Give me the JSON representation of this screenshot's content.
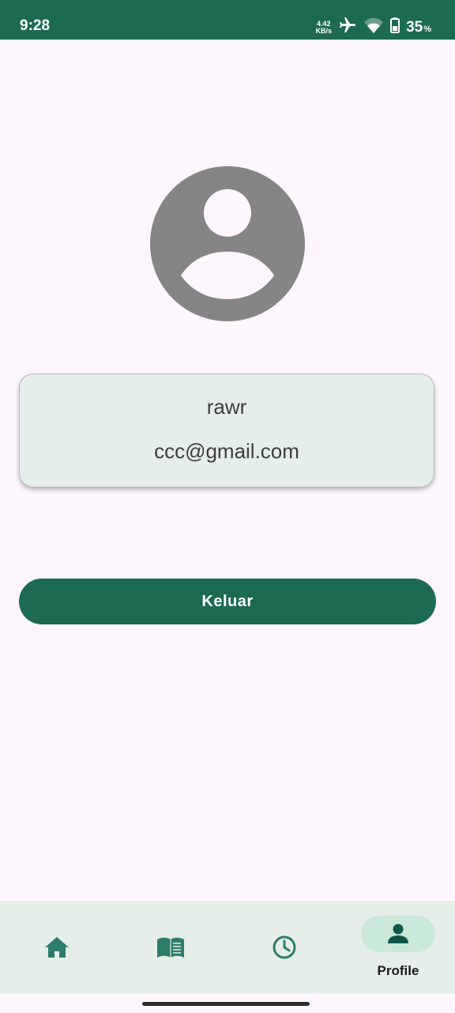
{
  "status_bar": {
    "time": "9:28",
    "net_speed_value": "4.42",
    "net_speed_unit": "KB/s",
    "battery_value": "35",
    "battery_unit": "%",
    "icons": [
      "airplane-mode-icon",
      "wifi-icon",
      "battery-icon"
    ]
  },
  "profile": {
    "avatar_icon": "account-circle-icon",
    "username": "rawr",
    "email": "ccc@gmail.com"
  },
  "actions": {
    "logout_label": "Keluar"
  },
  "bottom_nav": {
    "items": [
      {
        "icon": "home-icon",
        "label": ""
      },
      {
        "icon": "book-icon",
        "label": ""
      },
      {
        "icon": "clock-icon",
        "label": ""
      },
      {
        "icon": "person-icon",
        "label": "Profile",
        "selected": true
      }
    ]
  },
  "colors": {
    "primary": "#1C6A52",
    "background": "#FDF7FD",
    "card_background": "#E6EEEB",
    "nav_background": "#E6EEE9",
    "nav_selected_pill": "#C9E8DA",
    "avatar_gray": "#858585",
    "text_dark": "#3D3D3D",
    "nav_icon": "#2E7D6B"
  }
}
